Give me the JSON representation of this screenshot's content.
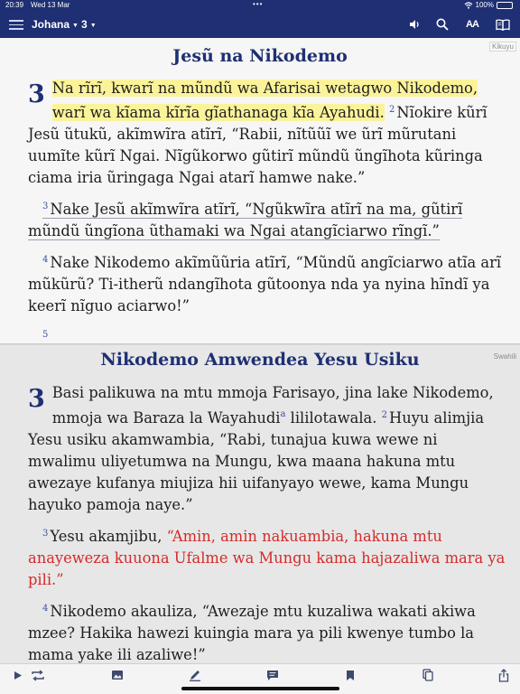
{
  "status": {
    "time": "20:39",
    "date": "Wed 13 Mar",
    "dots": "•••",
    "battery": "100%"
  },
  "nav": {
    "book": "Johana",
    "chapter": "3",
    "icons": [
      "menu-icon",
      "speaker-icon",
      "search-icon",
      "text-size-icon",
      "parallel-view-icon"
    ],
    "text_size_label": "AA"
  },
  "top": {
    "lang": "Kikuyu",
    "heading": "Jesũ na Nikodemo",
    "chapter_number": "3",
    "v1": "Na rĩrĩ, kwarĩ na mũndũ wa Afarisai wetagwo Nikodemo, warĩ wa kĩama kĩrĩa gĩathanaga kĩa Ayahudi.",
    "v2_num": "2",
    "v2": "Nĩokire kũrĩ Jesũ ũtukũ, akĩmwĩra atĩrĩ, “Rabii, nĩtũũĩ we ũrĩ mũrutani uumĩte kũrĩ Ngai. Nĩgũkorwo gũtirĩ mũndũ ũngĩhota kũringa ciama iria ũringaga Ngai atarĩ hamwe nake.”",
    "v3_num": "3",
    "v3": "Nake Jesũ akĩmwĩra atĩrĩ, “Ngũkwĩra atĩrĩ na ma, gũtirĩ mũndũ ũngĩona ũthamaki wa Ngai atangĩciarwo rĩngĩ.”",
    "v4_num": "4",
    "v4": "Nake Nikodemo akĩmũũria atĩrĩ, “Mũndũ angĩciarwo atĩa arĩ mũkũrũ? Ti-itherũ ndangĩhota gũtoonya nda ya nyina hĩndĩ ya keerĩ nĩguo aciarwo!”",
    "v5_num": "5"
  },
  "bottom": {
    "lang": "Swahili",
    "heading": "Nikodemo Amwendea Yesu Usiku",
    "chapter_number": "3",
    "v1a": "Basi palikuwa na mtu mmoja Farisayo, jina lake Nikodemo, mmoja wa Baraza la Wayahudi",
    "footnote": "a",
    "v1b": "lililotawala.",
    "v2_num": "2",
    "v2": "Huyu alimjia Yesu usiku akamwambia, “Rabi, tunajua kuwa wewe ni mwalimu uliyetumwa na Mungu, kwa maana hakuna mtu awezaye kufanya miujiza hii uifanyayo wewe, kama Mungu hayuko pamoja naye.”",
    "v3_num": "3",
    "v3_intro": "Yesu akamjibu,",
    "v3_words": "“Amin, amin nakuambia, hakuna mtu anayeweza kuuona Ufalme wa Mungu kama hajazaliwa mara ya pili.”",
    "v4_num": "4",
    "v4": "Nikodemo akauliza, “Awezaje mtu kuzaliwa wakati akiwa mzee? Hakika hawezi kuingia mara ya pili kwenye tumbo la mama yake ili azaliwe!”"
  },
  "toolbar": {
    "icons": [
      "play-icon",
      "repeat-icon",
      "image-icon",
      "pencil-icon",
      "notes-icon",
      "bookmark-icon",
      "copy-icon",
      "share-icon"
    ]
  },
  "colors": {
    "nav_bg": "#1e2f73",
    "heading": "#1e2f73",
    "highlight": "#fbf39a",
    "words_of_jesus": "#d42b2b"
  }
}
